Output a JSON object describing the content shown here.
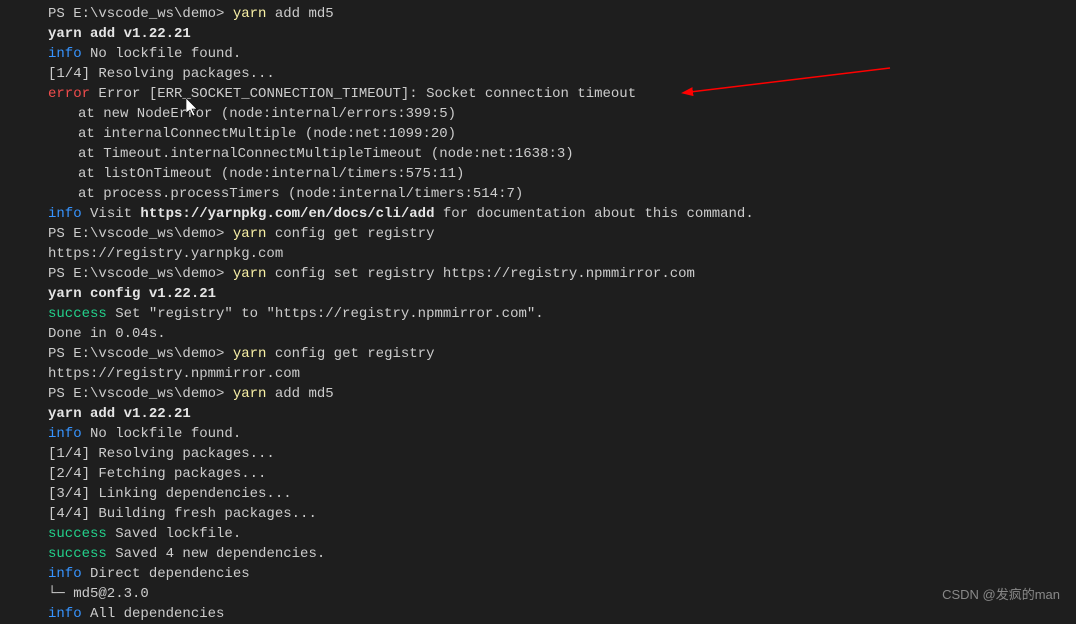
{
  "watermark": "CSDN @发疯的man",
  "lines": [
    {
      "segments": [
        {
          "cls": "prompt",
          "t": "PS E:\\vscode_ws\\demo> "
        },
        {
          "cls": "cmd-word",
          "t": "yarn "
        },
        {
          "cls": "",
          "t": "add md5"
        }
      ]
    },
    {
      "segments": [
        {
          "cls": "bold",
          "t": "yarn add v1.22.21"
        }
      ]
    },
    {
      "segments": [
        {
          "cls": "info",
          "t": "info"
        },
        {
          "cls": "",
          "t": " No lockfile found."
        }
      ]
    },
    {
      "segments": [
        {
          "cls": "",
          "t": "[1/4] Resolving packages..."
        }
      ]
    },
    {
      "segments": [
        {
          "cls": "error",
          "t": "error"
        },
        {
          "cls": "",
          "t": " Error [ERR_SOCKET_CONNECTION_TIMEOUT]: Socket connection timeout"
        }
      ]
    },
    {
      "cls": "indent",
      "segments": [
        {
          "cls": "",
          "t": "at new NodeError (node:internal/errors:399:5)"
        }
      ]
    },
    {
      "cls": "indent",
      "segments": [
        {
          "cls": "",
          "t": "at internalConnectMultiple (node:net:1099:20)"
        }
      ]
    },
    {
      "cls": "indent",
      "segments": [
        {
          "cls": "",
          "t": "at Timeout.internalConnectMultipleTimeout (node:net:1638:3)"
        }
      ]
    },
    {
      "cls": "indent",
      "segments": [
        {
          "cls": "",
          "t": "at listOnTimeout (node:internal/timers:575:11)"
        }
      ]
    },
    {
      "cls": "indent",
      "segments": [
        {
          "cls": "",
          "t": "at process.processTimers (node:internal/timers:514:7)"
        }
      ]
    },
    {
      "segments": [
        {
          "cls": "info",
          "t": "info"
        },
        {
          "cls": "",
          "t": " Visit "
        },
        {
          "cls": "bold",
          "t": "https://yarnpkg.com/en/docs/cli/add"
        },
        {
          "cls": "",
          "t": " for documentation about this command."
        }
      ]
    },
    {
      "segments": [
        {
          "cls": "prompt",
          "t": "PS E:\\vscode_ws\\demo> "
        },
        {
          "cls": "cmd-word",
          "t": "yarn "
        },
        {
          "cls": "",
          "t": "config get registry"
        }
      ]
    },
    {
      "segments": [
        {
          "cls": "",
          "t": "https://registry.yarnpkg.com"
        }
      ]
    },
    {
      "segments": [
        {
          "cls": "prompt",
          "t": "PS E:\\vscode_ws\\demo> "
        },
        {
          "cls": "cmd-word",
          "t": "yarn "
        },
        {
          "cls": "",
          "t": "config set registry https://registry.npmmirror.com"
        }
      ]
    },
    {
      "segments": [
        {
          "cls": "bold",
          "t": "yarn config v1.22.21"
        }
      ]
    },
    {
      "segments": [
        {
          "cls": "success",
          "t": "success"
        },
        {
          "cls": "",
          "t": " Set \"registry\" to \"https://registry.npmmirror.com\"."
        }
      ]
    },
    {
      "segments": [
        {
          "cls": "",
          "t": "Done in 0.04s."
        }
      ]
    },
    {
      "segments": [
        {
          "cls": "prompt",
          "t": "PS E:\\vscode_ws\\demo> "
        },
        {
          "cls": "cmd-word",
          "t": "yarn "
        },
        {
          "cls": "",
          "t": "config get registry"
        }
      ]
    },
    {
      "segments": [
        {
          "cls": "",
          "t": "https://registry.npmmirror.com"
        }
      ]
    },
    {
      "segments": [
        {
          "cls": "prompt",
          "t": "PS E:\\vscode_ws\\demo> "
        },
        {
          "cls": "cmd-word",
          "t": "yarn "
        },
        {
          "cls": "",
          "t": "add md5"
        }
      ]
    },
    {
      "segments": [
        {
          "cls": "bold",
          "t": "yarn add v1.22.21"
        }
      ]
    },
    {
      "segments": [
        {
          "cls": "info",
          "t": "info"
        },
        {
          "cls": "",
          "t": " No lockfile found."
        }
      ]
    },
    {
      "segments": [
        {
          "cls": "",
          "t": "[1/4] Resolving packages..."
        }
      ]
    },
    {
      "segments": [
        {
          "cls": "",
          "t": "[2/4] Fetching packages..."
        }
      ]
    },
    {
      "segments": [
        {
          "cls": "",
          "t": "[3/4] Linking dependencies..."
        }
      ]
    },
    {
      "segments": [
        {
          "cls": "",
          "t": "[4/4] Building fresh packages..."
        }
      ]
    },
    {
      "segments": [
        {
          "cls": "success",
          "t": "success"
        },
        {
          "cls": "",
          "t": " Saved lockfile."
        }
      ]
    },
    {
      "segments": [
        {
          "cls": "success",
          "t": "success"
        },
        {
          "cls": "",
          "t": " Saved 4 new dependencies."
        }
      ]
    },
    {
      "segments": [
        {
          "cls": "info",
          "t": "info"
        },
        {
          "cls": "",
          "t": " Direct dependencies"
        }
      ]
    },
    {
      "segments": [
        {
          "cls": "",
          "t": "└─ md5@2.3.0"
        }
      ]
    },
    {
      "segments": [
        {
          "cls": "info",
          "t": "info"
        },
        {
          "cls": "",
          "t": " All dependencies"
        }
      ]
    }
  ]
}
